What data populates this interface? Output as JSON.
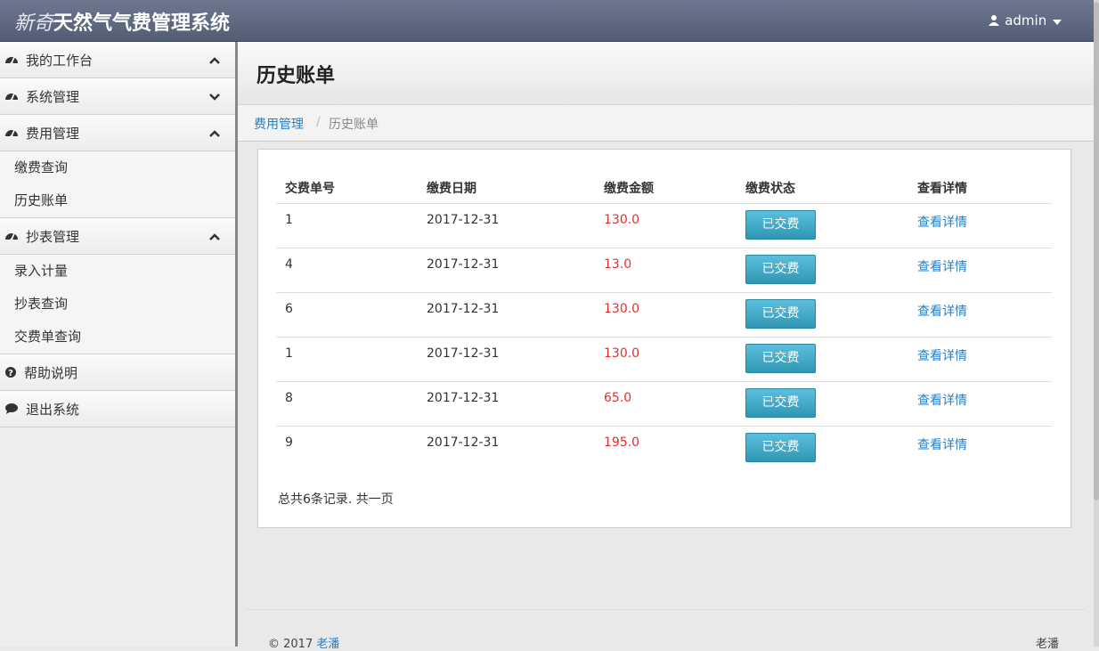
{
  "header": {
    "brand_italic": "新奇",
    "brand_bold": "天然气气费管理系统",
    "user": "admin",
    "user_icon": "user-icon",
    "caret_icon": "caret-down-icon"
  },
  "sidebar": {
    "groups": [
      {
        "label": "我的工作台",
        "icon": "dashboard-icon",
        "state": "up"
      },
      {
        "label": "系统管理",
        "icon": "dashboard-icon",
        "state": "down"
      },
      {
        "label": "费用管理",
        "icon": "dashboard-icon",
        "state": "up",
        "items": [
          "缴费查询",
          "历史账单"
        ]
      },
      {
        "label": "抄表管理",
        "icon": "dashboard-icon",
        "state": "up",
        "items": [
          "录入计量",
          "抄表查询",
          "交费单查询"
        ]
      },
      {
        "label": "帮助说明",
        "icon": "question-circle-icon"
      },
      {
        "label": "退出系统",
        "icon": "comment-icon"
      }
    ]
  },
  "page": {
    "title": "历史账单",
    "breadcrumb": [
      "费用管理",
      "历史账单"
    ]
  },
  "table": {
    "headers": [
      "交费单号",
      "缴费日期",
      "缴费金额",
      "缴费状态",
      "查看详情"
    ],
    "rows": [
      {
        "id": "1",
        "date": "2017-12-31",
        "amount": "130.0",
        "status": "已交费",
        "detail": "查看详情"
      },
      {
        "id": "4",
        "date": "2017-12-31",
        "amount": "13.0",
        "status": "已交费",
        "detail": "查看详情"
      },
      {
        "id": "6",
        "date": "2017-12-31",
        "amount": "130.0",
        "status": "已交费",
        "detail": "查看详情"
      },
      {
        "id": "1",
        "date": "2017-12-31",
        "amount": "130.0",
        "status": "已交费",
        "detail": "查看详情"
      },
      {
        "id": "8",
        "date": "2017-12-31",
        "amount": "65.0",
        "status": "已交费",
        "detail": "查看详情"
      },
      {
        "id": "9",
        "date": "2017-12-31",
        "amount": "195.0",
        "status": "已交费",
        "detail": "查看详情"
      }
    ],
    "summary": "总共6条记录. 共一页"
  },
  "footer": {
    "copyright": "© 2017",
    "author_link": "老潘",
    "right": "老潘"
  },
  "colors": {
    "header_bg": "#5d6780",
    "link": "#2a7fc0",
    "amount": "#e0302d",
    "button": "#3aa6c7"
  }
}
